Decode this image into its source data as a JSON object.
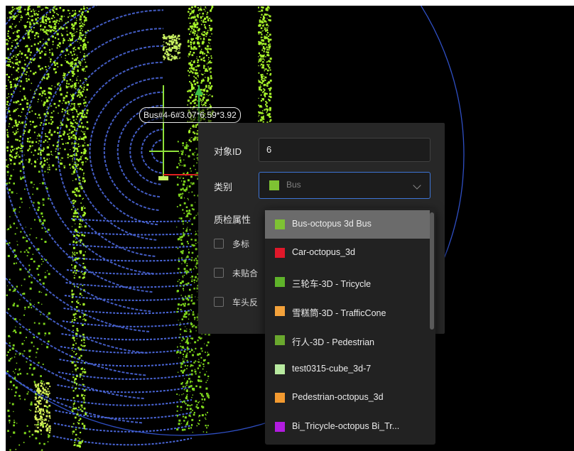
{
  "bbox_label": "Bus#4-6#3.07*6.59*3.92",
  "panel": {
    "id_label": "对象ID",
    "id_value": "6",
    "category_label": "类别",
    "category_value": "Bus",
    "category_color": "#7ec233",
    "qc_label": "质检属性",
    "checkboxes": [
      "多标",
      "未贴合",
      "车头反"
    ]
  },
  "dropdown": {
    "options": [
      {
        "label": "Bus-octopus 3d Bus",
        "color": "#7ec233",
        "highlighted": true
      },
      {
        "label": "Car-octopus_3d",
        "color": "#e0182a"
      },
      {
        "label": "三轮车-3D - Tricycle",
        "color": "#5fb32a"
      },
      {
        "label": "雪糕筒-3D - TrafficCone",
        "color": "#f4a23b"
      },
      {
        "label": "行人-3D - Pedestrian",
        "color": "#6aa82e"
      },
      {
        "label": "test0315-cube_3d-7",
        "color": "#b8eaa0"
      },
      {
        "label": "Pedestrian-octopus_3d",
        "color": "#f39a30"
      },
      {
        "label": "Bi_Tricycle-octopus Bi_Tr...",
        "color": "#b21ce0"
      }
    ]
  }
}
